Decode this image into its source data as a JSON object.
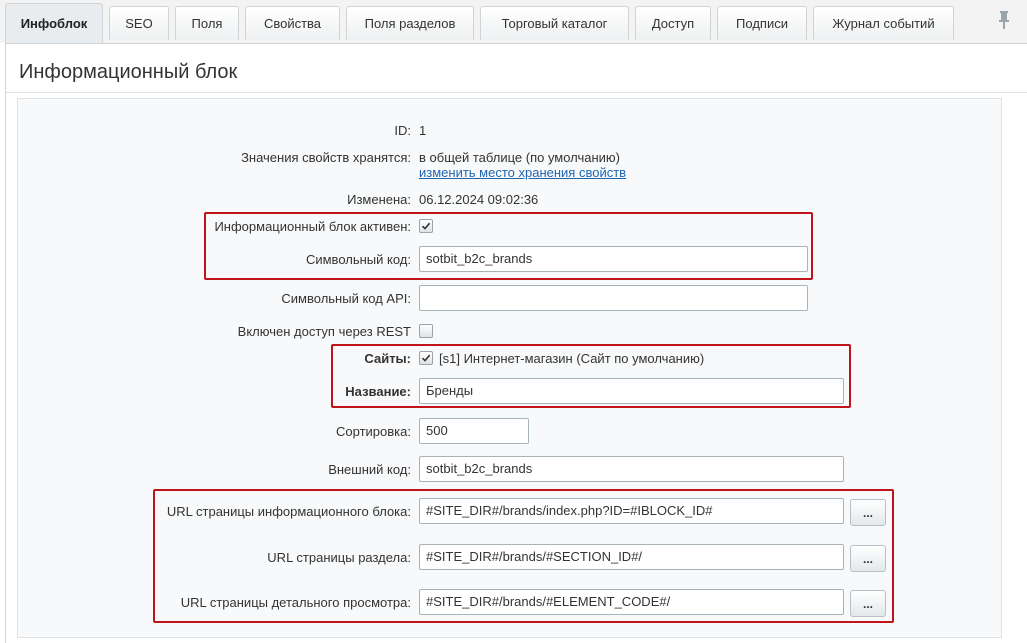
{
  "tabs": [
    {
      "label": "Инфоблок",
      "active": true
    },
    {
      "label": "SEO"
    },
    {
      "label": "Поля"
    },
    {
      "label": "Свойства"
    },
    {
      "label": "Поля разделов"
    },
    {
      "label": "Торговый каталог"
    },
    {
      "label": "Доступ"
    },
    {
      "label": "Подписи"
    },
    {
      "label": "Журнал событий"
    }
  ],
  "pin_icon": "pin-icon",
  "page_title": "Информационный блок",
  "form": {
    "id_label": "ID:",
    "id_value": "1",
    "storage_label": "Значения свойств хранятся:",
    "storage_value": "в общей таблице (по умолчанию)",
    "storage_link": "изменить место хранения свойств",
    "modified_label": "Изменена:",
    "modified_value": "06.12.2024 09:02:36",
    "active_label": "Информационный блок активен:",
    "active_checked": true,
    "code_label": "Символьный код:",
    "code_value": "sotbit_b2c_brands",
    "api_code_label": "Символьный код API:",
    "api_code_value": "",
    "rest_label": "Включен доступ через REST",
    "rest_checked": false,
    "sites_label": "Сайты:",
    "sites_checked": true,
    "sites_value": "[s1] Интернет-магазин (Сайт по умолчанию)",
    "name_label": "Название:",
    "name_value": "Бренды",
    "sort_label": "Сортировка:",
    "sort_value": "500",
    "xml_label": "Внешний код:",
    "xml_value": "sotbit_b2c_brands",
    "list_url_label": "URL страницы информационного блока:",
    "list_url_value": "#SITE_DIR#/brands/index.php?ID=#IBLOCK_ID#",
    "section_url_label": "URL страницы раздела:",
    "section_url_value": "#SITE_DIR#/brands/#SECTION_ID#/",
    "detail_url_label": "URL страницы детального просмотра:",
    "detail_url_value": "#SITE_DIR#/brands/#ELEMENT_CODE#/",
    "browse_button_label": "..."
  },
  "colors": {
    "highlight": "#c0141a",
    "link": "#2067b0"
  }
}
